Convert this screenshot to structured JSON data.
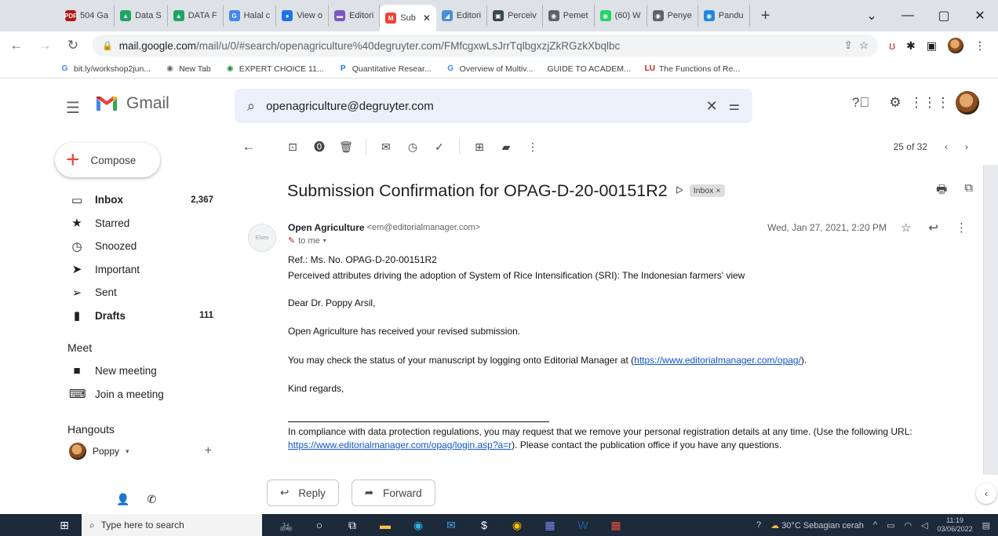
{
  "browser": {
    "tabs": [
      {
        "label": "504 Ga",
        "icon": "pdf-icon",
        "color": "#b31412",
        "glyph": "PDF"
      },
      {
        "label": "Data S",
        "icon": "google-drive-icon",
        "color": "#1fa463",
        "glyph": "▲"
      },
      {
        "label": "DATA F",
        "icon": "google-drive-icon",
        "color": "#1fa463",
        "glyph": "▲"
      },
      {
        "label": "Halal c",
        "icon": "google-icon",
        "color": "#4285f4",
        "glyph": "G"
      },
      {
        "label": "View o",
        "icon": "globe-icon",
        "color": "#1a73e8",
        "glyph": "●"
      },
      {
        "label": "Editori",
        "icon": "editorial-icon",
        "color": "#7e57c2",
        "glyph": "▬"
      },
      {
        "label": "Sub",
        "icon": "gmail-icon",
        "color": "#ea4335",
        "glyph": "M",
        "active": true
      },
      {
        "label": "Editori",
        "icon": "editorial-icon",
        "color": "#4a90d9",
        "glyph": "◢"
      },
      {
        "label": "Perceiv",
        "icon": "paper-icon",
        "color": "#37474f",
        "glyph": "▣"
      },
      {
        "label": "Pemet",
        "icon": "globe-icon",
        "color": "#5f6368",
        "glyph": "◉"
      },
      {
        "label": "(60) W",
        "icon": "whatsapp-icon",
        "color": "#25d366",
        "glyph": "◉"
      },
      {
        "label": "Penye",
        "icon": "globe-icon",
        "color": "#5f6368",
        "glyph": "◉"
      },
      {
        "label": "Pandu",
        "icon": "guide-icon",
        "color": "#1e88e5",
        "glyph": "◉"
      }
    ],
    "address": {
      "domain": "mail.google.com",
      "path": "/mail/u/0/#search/openagriculture%40degruyter.com/FMfcgxwLsJrrTqlbgxzjZkRGzkXbqlbc"
    },
    "bookmarks": [
      {
        "label": "bit.ly/workshop2jun...",
        "glyph": "G",
        "color": "#4285f4"
      },
      {
        "label": "New Tab",
        "glyph": "◉",
        "color": "#5f6368"
      },
      {
        "label": "EXPERT CHOICE 11...",
        "glyph": "◉",
        "color": "#1e8e3e"
      },
      {
        "label": "Quantitative Resear...",
        "glyph": "P",
        "color": "#1a73e8"
      },
      {
        "label": "Overview of Multiv...",
        "glyph": "G",
        "color": "#4285f4"
      },
      {
        "label": "GUIDE TO ACADEM...",
        "glyph": "",
        "color": "#5f6368"
      },
      {
        "label": "The Functions of Re...",
        "glyph": "LU",
        "color": "#c5221f"
      }
    ]
  },
  "gmail": {
    "logo_text": "Gmail",
    "search_query": "openagriculture@degruyter.com",
    "compose_label": "Compose",
    "nav": [
      {
        "label": "Inbox",
        "count": "2,367",
        "icon": "inbox-icon",
        "glyph": "▭",
        "bold": true
      },
      {
        "label": "Starred",
        "count": "",
        "icon": "star-icon",
        "glyph": "★",
        "bold": false
      },
      {
        "label": "Snoozed",
        "count": "",
        "icon": "clock-icon",
        "glyph": "◷",
        "bold": false
      },
      {
        "label": "Important",
        "count": "",
        "icon": "important-icon",
        "glyph": "➤",
        "bold": false
      },
      {
        "label": "Sent",
        "count": "",
        "icon": "send-icon",
        "glyph": "➢",
        "bold": false
      },
      {
        "label": "Drafts",
        "count": "111",
        "icon": "draft-icon",
        "glyph": "▮",
        "bold": true
      }
    ],
    "meet": {
      "title": "Meet",
      "items": [
        {
          "label": "New meeting",
          "icon": "video-icon",
          "glyph": "■"
        },
        {
          "label": "Join a meeting",
          "icon": "keyboard-icon",
          "glyph": "⌨"
        }
      ]
    },
    "hangouts": {
      "title": "Hangouts",
      "user": "Poppy"
    },
    "pager": "25 of 32",
    "message": {
      "subject": "Submission Confirmation for OPAG-D-20-00151R2",
      "label": "Inbox",
      "sender_name": "Open Agriculture",
      "sender_email": "<em@editorialmanager.com>",
      "date": "Wed, Jan 27, 2021, 2:20 PM",
      "to": "to me",
      "body": {
        "ref": "Ref.:  Ms. No. OPAG-D-20-00151R2",
        "title": "Perceived attributes driving the adoption of  System of Rice Intensification (SRI): The Indonesian farmers' view",
        "greeting": "Dear Dr. Poppy Arsil,",
        "received": "Open Agriculture has received your revised submission.",
        "check_prefix": "You may check the status of your manuscript by logging onto Editorial Manager at (",
        "check_link": "https://www.editorialmanager.com/opag/",
        "check_suffix": ").",
        "regards": "Kind regards,",
        "compliance": "In compliance with data protection regulations, you may request that we remove your personal registration details at any time.  (Use the following URL:",
        "compliance_link": "https://www.editorialmanager.com/opag/login.asp?a=r",
        "compliance_suffix": "). Please contact the publication office if you have any questions."
      },
      "reply_label": "Reply",
      "forward_label": "Forward"
    }
  },
  "taskbar": {
    "search_placeholder": "Type here to search",
    "weather": "30°C  Sebagian cerah",
    "time": "11:19",
    "date": "03/06/2022"
  }
}
